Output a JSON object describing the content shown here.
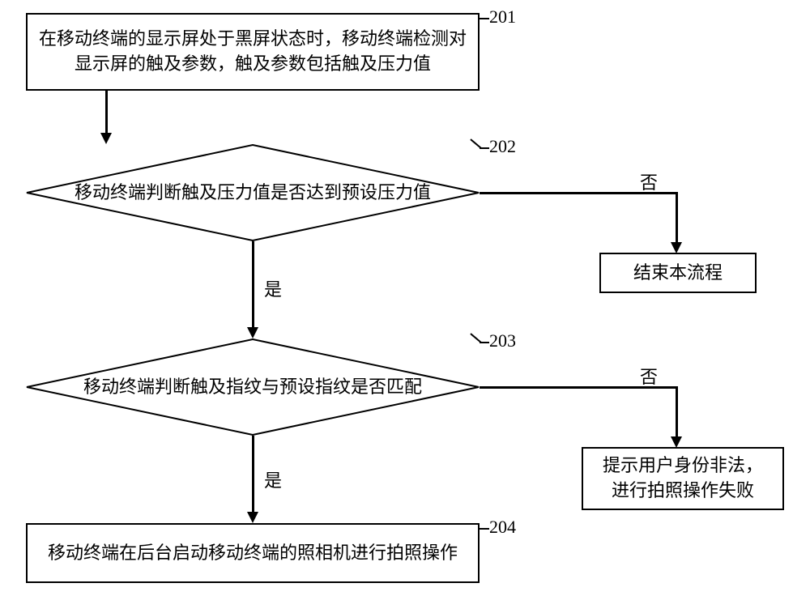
{
  "steps": {
    "201": {
      "num": "201",
      "text": "在移动终端的显示屏处于黑屏状态时，移动终端检测对显示屏的触及参数，触及参数包括触及压力值"
    },
    "202": {
      "num": "202",
      "text": "移动终端判断触及压力值是否达到预设压力值"
    },
    "203": {
      "num": "203",
      "text": "移动终端判断触及指纹与预设指纹是否匹配"
    },
    "204": {
      "num": "204",
      "text": "移动终端在后台启动移动终端的照相机进行拍照操作"
    }
  },
  "end_box": "结束本流程",
  "fail_box": "提示用户身份非法，进行拍照操作失败",
  "labels": {
    "yes": "是",
    "no": "否"
  }
}
